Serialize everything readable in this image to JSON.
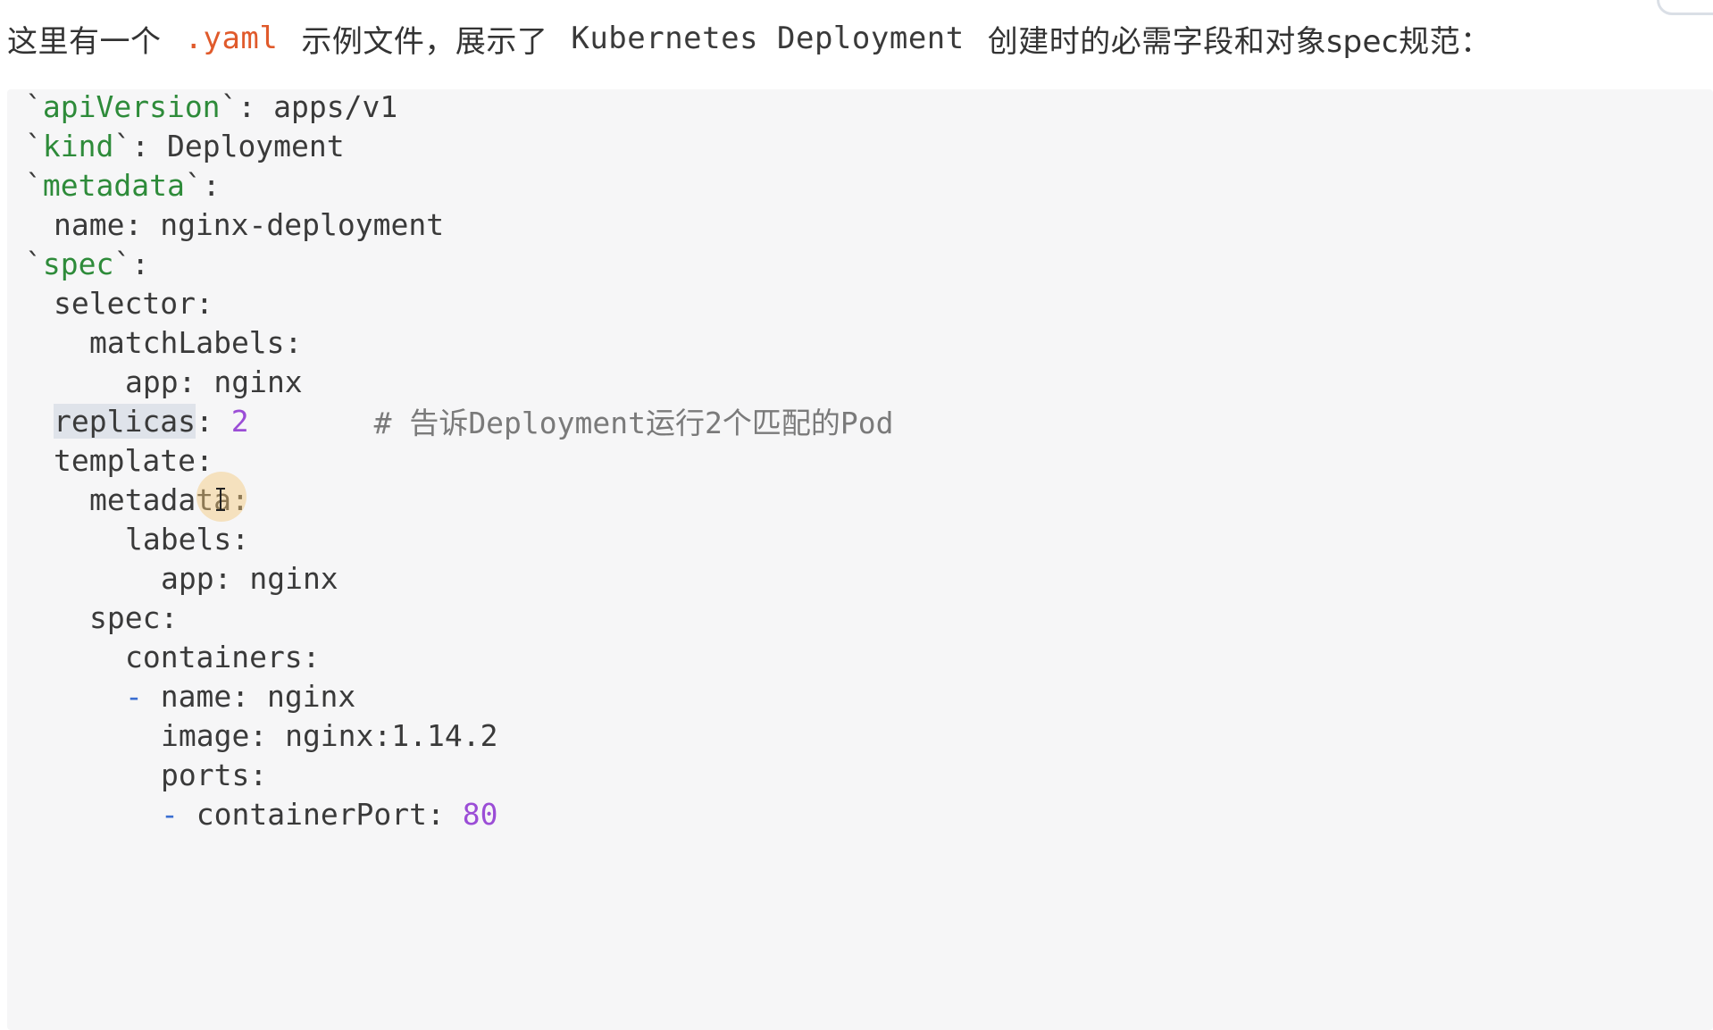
{
  "intro": {
    "part1": "这里有一个",
    "ext": ".yaml",
    "part2": "示例文件，展示了",
    "kind_word": "Kubernetes Deployment",
    "part3": "创建时的必需字段和对象spec规范："
  },
  "code": {
    "apiVersion_key": "apiVersion",
    "apiVersion_value": "apps/v1",
    "kind_key": "kind",
    "kind_value": "Deployment",
    "metadata_key": "metadata",
    "name_line": "name: nginx-deployment",
    "spec_key": "spec",
    "selector_line": "selector:",
    "matchLabels_line": "matchLabels:",
    "app_line": "app: nginx",
    "replicas_key": "replicas",
    "replicas_value": "2",
    "replicas_comment": "# 告诉Deployment运行2个匹配的Pod",
    "template_line": "template:",
    "template_metadata_line": "metadata:",
    "labels_line": "labels:",
    "labels_app_line": "app: nginx",
    "inner_spec_line": "spec:",
    "containers_line": "containers:",
    "container_name_line": "name: nginx",
    "image_line": "image: nginx:1.14.2",
    "ports_line": "ports:",
    "containerPort_key": "containerPort:",
    "containerPort_value": "80"
  },
  "colors": {
    "key_green": "#2e8b3a",
    "number_purple": "#9b4dd6",
    "extension_orange": "#e05a2b",
    "list_dash_blue": "#3b6fd1",
    "code_background": "#f6f6f7"
  }
}
